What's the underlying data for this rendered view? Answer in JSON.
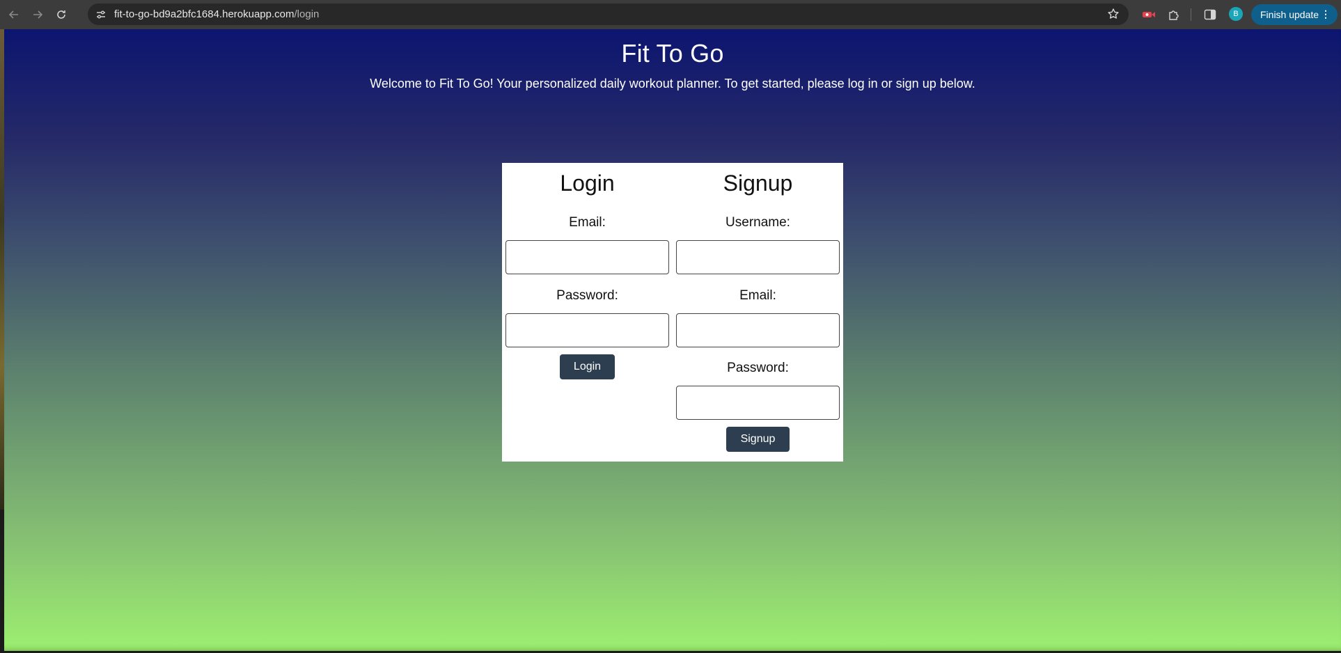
{
  "browser": {
    "url_host": "fit-to-go-bd9a2bfc1684.herokuapp.com",
    "url_path": "/login",
    "profile_initial": "B",
    "update_button": "Finish update",
    "icons": [
      "back-arrow-icon",
      "forward-arrow-icon",
      "reload-icon",
      "site-settings-icon",
      "bookmark-star-icon",
      "extension-icon",
      "puzzle-icon",
      "side-panel-icon",
      "more-vert-icon"
    ]
  },
  "page": {
    "title": "Fit To Go",
    "welcome": "Welcome to Fit To Go! Your personalized daily workout planner. To get started, please log in or sign up below.",
    "background_top": "#0c1570",
    "background_bottom": "#9def70"
  },
  "login": {
    "heading": "Login",
    "email_label": "Email:",
    "email_value": "",
    "password_label": "Password:",
    "password_value": "",
    "button": "Login"
  },
  "signup": {
    "heading": "Signup",
    "username_label": "Username:",
    "username_value": "",
    "email_label": "Email:",
    "email_value": "",
    "password_label": "Password:",
    "password_value": "",
    "button": "Signup"
  },
  "colors": {
    "button_bg": "#2c3e50",
    "update_button_bg": "#0f5f8c",
    "avatar_bg": "#1aa6b7"
  }
}
